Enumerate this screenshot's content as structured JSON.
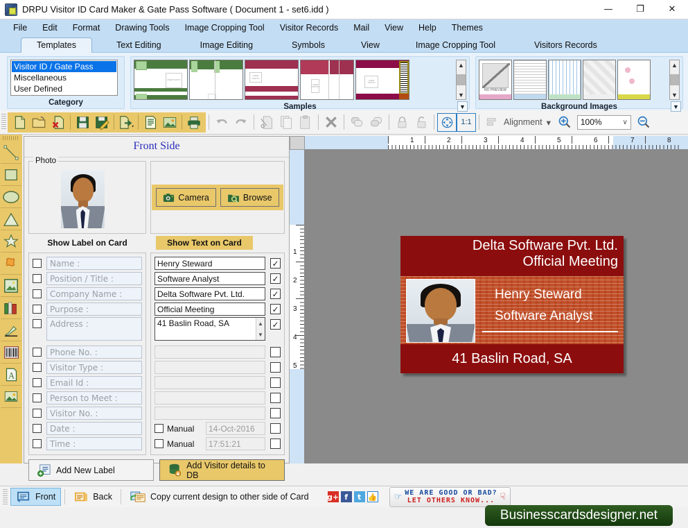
{
  "window": {
    "title": "DRPU Visitor ID Card Maker & Gate Pass Software ( Document 1 - set6.idd )",
    "app_icon": "app-icon",
    "minimize": "—",
    "maximize": "❐",
    "close": "✕"
  },
  "menubar": {
    "items": [
      {
        "label": "File"
      },
      {
        "label": "Edit"
      },
      {
        "label": "Format"
      },
      {
        "label": "Drawing Tools"
      },
      {
        "label": "Image Cropping Tool"
      },
      {
        "label": "Visitor Records"
      },
      {
        "label": "Mail"
      },
      {
        "label": "View"
      },
      {
        "label": "Help"
      },
      {
        "label": "Themes"
      }
    ]
  },
  "ribbon_tabs": {
    "items": [
      {
        "label": "Templates",
        "active": true
      },
      {
        "label": "Text Editing",
        "active": false
      },
      {
        "label": "Image Editing",
        "active": false
      },
      {
        "label": "Symbols",
        "active": false
      },
      {
        "label": "View",
        "active": false
      },
      {
        "label": "Image Cropping Tool",
        "active": false
      },
      {
        "label": "Visitors Records",
        "active": false
      }
    ]
  },
  "ribbon": {
    "category": {
      "caption": "Category",
      "items": [
        {
          "label": "Visitor ID / Gate Pass",
          "selected": true
        },
        {
          "label": "Miscellaneous",
          "selected": false
        },
        {
          "label": "User Defined",
          "selected": false
        }
      ]
    },
    "samples": {
      "caption": "Samples",
      "more_icon": "expand-down-icon",
      "scroll_up_icon": "chevron-up-icon",
      "scroll_down_icon": "chevron-down-icon",
      "thumbs": [
        {
          "name": "sample-green-1",
          "photo_label": "USER PHOTO"
        },
        {
          "name": "sample-green-2",
          "photo_label": "USER PHOTO"
        },
        {
          "name": "sample-maroon-1",
          "photo_label": "USER PHOTO"
        },
        {
          "name": "sample-maroon-2",
          "photo_label": "USER PHOTO"
        },
        {
          "name": "sample-maroon-barcode",
          "photo_label": "USER PHOTO"
        }
      ]
    },
    "backgrounds": {
      "caption": "Background Images",
      "more_icon": "expand-down-icon",
      "no_preview_label": "NO PREVIEW",
      "thumbs": [
        {
          "name": "bg-no-preview"
        },
        {
          "name": "bg-text-pattern"
        },
        {
          "name": "bg-blue-grid"
        },
        {
          "name": "bg-grey-tiles"
        },
        {
          "name": "bg-floral"
        }
      ]
    }
  },
  "toolbar": {
    "buttons": [
      {
        "name": "new-document-icon",
        "title": "New"
      },
      {
        "name": "open-folder-icon",
        "title": "Open"
      },
      {
        "name": "close-document-icon",
        "title": "Close"
      },
      {
        "name": "save-icon",
        "title": "Save"
      },
      {
        "name": "save-as-icon",
        "title": "Save As"
      },
      {
        "name": "export-icon",
        "title": "Export"
      },
      {
        "name": "text-document-icon",
        "title": "Text"
      },
      {
        "name": "image-icon",
        "title": "Image"
      },
      {
        "name": "print-icon",
        "title": "Print"
      },
      {
        "name": "undo-icon",
        "title": "Undo"
      },
      {
        "name": "redo-icon",
        "title": "Redo"
      },
      {
        "name": "cut-icon",
        "title": "Cut"
      },
      {
        "name": "copy-icon",
        "title": "Copy"
      },
      {
        "name": "paste-icon",
        "title": "Paste"
      },
      {
        "name": "delete-icon",
        "title": "Delete"
      },
      {
        "name": "bring-front-icon",
        "title": "Bring to Front"
      },
      {
        "name": "send-back-icon",
        "title": "Send to Back"
      },
      {
        "name": "lock-icon",
        "title": "Lock"
      },
      {
        "name": "unlock-icon",
        "title": "Unlock"
      },
      {
        "name": "fit-to-screen-icon",
        "title": "Fit to Screen"
      },
      {
        "name": "actual-size-icon",
        "title": "1:1"
      }
    ],
    "actual_size_label": "1:1",
    "alignment_label": "Alignment",
    "alignment_caret": "▾",
    "zoom_in_icon": "zoom-in-icon",
    "zoom_out_icon": "zoom-out-icon",
    "zoom_value": "100%",
    "zoom_caret": "∨"
  },
  "vtoolbar": {
    "buttons": [
      {
        "name": "line-tool-icon"
      },
      {
        "name": "rectangle-tool-icon"
      },
      {
        "name": "ellipse-tool-icon"
      },
      {
        "name": "triangle-tool-icon"
      },
      {
        "name": "star-tool-icon"
      },
      {
        "name": "shape-tool-icon"
      },
      {
        "name": "picture-tool-icon"
      },
      {
        "name": "library-tool-icon"
      },
      {
        "name": "signature-tool-icon"
      },
      {
        "name": "barcode-tool-icon"
      },
      {
        "name": "text-tool-icon"
      },
      {
        "name": "background-tool-icon"
      }
    ]
  },
  "form": {
    "side_title": "Front Side",
    "photo_group_label": "Photo",
    "camera_button": "Camera",
    "camera_icon": "camera-icon",
    "browse_button": "Browse",
    "browse_icon": "folder-search-icon",
    "show_label_header": "Show Label on Card",
    "show_text_header": "Show Text on Card",
    "fields": [
      {
        "label": "Name :",
        "value": "Henry Steward",
        "checked": true,
        "tall": false,
        "enabled": true
      },
      {
        "label": "Position / Title :",
        "value": "Software Analyst",
        "checked": true,
        "tall": false,
        "enabled": true
      },
      {
        "label": "Company Name :",
        "value": "Delta Software Pvt. Ltd.",
        "checked": true,
        "tall": false,
        "enabled": true
      },
      {
        "label": "Purpose :",
        "value": "Official Meeting",
        "checked": true,
        "tall": false,
        "enabled": true
      },
      {
        "label": "Address :",
        "value": "41 Baslin Road, SA",
        "checked": true,
        "tall": true,
        "enabled": true
      },
      {
        "label": "Phone No. :",
        "value": "",
        "checked": false,
        "tall": false,
        "enabled": false
      },
      {
        "label": "Visitor Type :",
        "value": "",
        "checked": false,
        "tall": false,
        "enabled": false
      },
      {
        "label": "Email Id :",
        "value": "",
        "checked": false,
        "tall": false,
        "enabled": false
      },
      {
        "label": "Person to Meet :",
        "value": "",
        "checked": false,
        "tall": false,
        "enabled": false
      },
      {
        "label": "Visitor No. :",
        "value": "",
        "checked": false,
        "tall": false,
        "enabled": false
      }
    ],
    "datetime": [
      {
        "label": "Date :",
        "manual_label": "Manual",
        "manual_checked": false,
        "value": "14-Oct-2016",
        "checked": false
      },
      {
        "label": "Time :",
        "manual_label": "Manual",
        "manual_checked": false,
        "value": "17:51:21",
        "checked": false
      }
    ],
    "checked_glyph": "✓",
    "add_new_label_button": "Add New Label",
    "add_new_label_icon": "add-label-icon",
    "add_to_db_button": "Add Visitor details to DB",
    "add_to_db_icon": "database-add-icon"
  },
  "canvas": {
    "ruler_h_ticks": [
      "1",
      "2",
      "3",
      "4",
      "5",
      "6",
      "7",
      "8"
    ],
    "ruler_v_ticks": [
      "1",
      "2",
      "3",
      "4",
      "5"
    ],
    "card": {
      "company": "Delta Software Pvt. Ltd.",
      "purpose": "Official Meeting",
      "name": "Henry Steward",
      "position": "Software Analyst",
      "address": "41 Baslin Road, SA",
      "photo_name": "visitor-photo",
      "color_header": "#8c0d0d",
      "color_middle": "#c1502a",
      "color_footer": "#8c0d0d"
    }
  },
  "statusbar": {
    "front_label": "Front",
    "front_icon": "front-side-icon",
    "back_label": "Back",
    "back_icon": "back-side-icon",
    "copy_label": "Copy current design to other side of Card",
    "copy_icon": "copy-design-icon",
    "social": [
      {
        "name": "google-plus-icon",
        "glyph": "g+",
        "color": "#d93025"
      },
      {
        "name": "facebook-icon",
        "glyph": "f",
        "color": "#3b5998"
      },
      {
        "name": "twitter-icon",
        "glyph": "t",
        "color": "#4fa8e0"
      },
      {
        "name": "thumbs-up-icon",
        "glyph": "ὄD",
        "color": "#2f7fd1"
      }
    ],
    "feedback_line1": "WE ARE GOOD OR BAD?",
    "feedback_line2": "LET OTHERS KNOW...",
    "feedback_up_icon": "thumbs-up-icon",
    "feedback_down_icon": "thumbs-down-icon",
    "brand": "Businesscardsdesigner.net"
  }
}
